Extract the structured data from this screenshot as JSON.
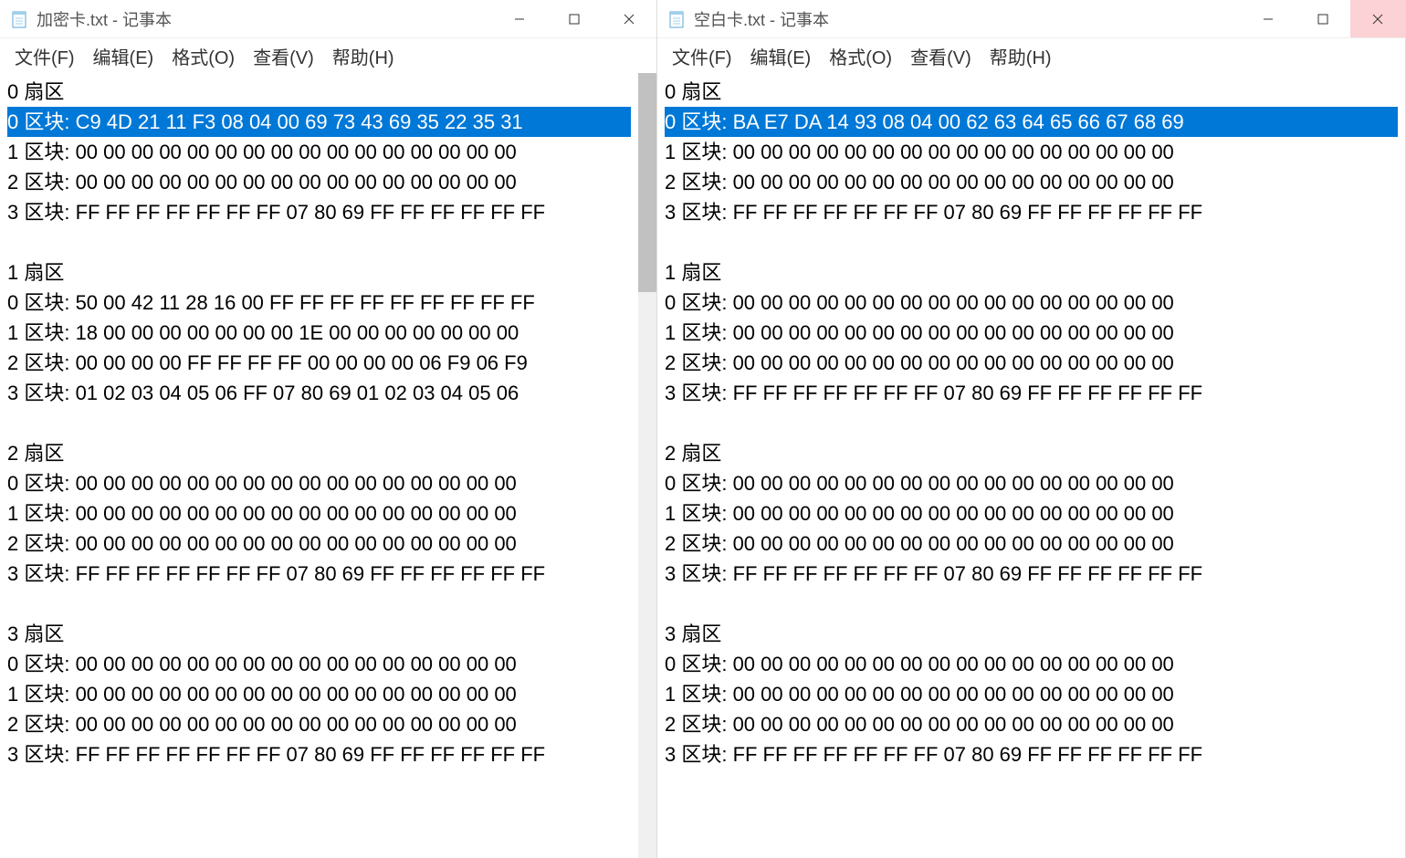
{
  "windows": [
    {
      "title": "加密卡.txt - 记事本",
      "close_style": "normal",
      "has_scrollbar": true,
      "menu": [
        "文件(F)",
        "编辑(E)",
        "格式(O)",
        "查看(V)",
        "帮助(H)"
      ],
      "sectors": [
        {
          "header": "0 扇区",
          "blocks": [
            {
              "text": "0 区块: C9 4D 21 11 F3 08 04 00 69 73 43 69 35 22 35 31",
              "selected": true
            },
            {
              "text": "1 区块: 00 00 00 00 00 00 00 00 00 00 00 00 00 00 00 00",
              "selected": false
            },
            {
              "text": "2 区块: 00 00 00 00 00 00 00 00 00 00 00 00 00 00 00 00",
              "selected": false
            },
            {
              "text": "3 区块: FF FF FF FF FF FF FF 07 80 69 FF FF FF FF FF FF",
              "selected": false
            }
          ]
        },
        {
          "header": "1 扇区",
          "blocks": [
            {
              "text": "0 区块: 50 00 42 11 28 16 00 FF FF FF FF FF FF FF FF FF",
              "selected": false
            },
            {
              "text": "1 区块: 18 00 00 00 00 00 00 00 1E 00 00 00 00 00 00 00",
              "selected": false
            },
            {
              "text": "2 区块: 00 00 00 00 FF FF FF FF 00 00 00 00 06 F9 06 F9",
              "selected": false
            },
            {
              "text": "3 区块: 01 02 03 04 05 06 FF 07 80 69 01 02 03 04 05 06",
              "selected": false
            }
          ]
        },
        {
          "header": "2 扇区",
          "blocks": [
            {
              "text": "0 区块: 00 00 00 00 00 00 00 00 00 00 00 00 00 00 00 00",
              "selected": false
            },
            {
              "text": "1 区块: 00 00 00 00 00 00 00 00 00 00 00 00 00 00 00 00",
              "selected": false
            },
            {
              "text": "2 区块: 00 00 00 00 00 00 00 00 00 00 00 00 00 00 00 00",
              "selected": false
            },
            {
              "text": "3 区块: FF FF FF FF FF FF FF 07 80 69 FF FF FF FF FF FF",
              "selected": false
            }
          ]
        },
        {
          "header": "3 扇区",
          "blocks": [
            {
              "text": "0 区块: 00 00 00 00 00 00 00 00 00 00 00 00 00 00 00 00",
              "selected": false
            },
            {
              "text": "1 区块: 00 00 00 00 00 00 00 00 00 00 00 00 00 00 00 00",
              "selected": false
            },
            {
              "text": "2 区块: 00 00 00 00 00 00 00 00 00 00 00 00 00 00 00 00",
              "selected": false
            },
            {
              "text": "3 区块: FF FF FF FF FF FF FF 07 80 69 FF FF FF FF FF FF",
              "selected": false
            }
          ]
        }
      ]
    },
    {
      "title": "空白卡.txt - 记事本",
      "close_style": "pink",
      "has_scrollbar": false,
      "menu": [
        "文件(F)",
        "编辑(E)",
        "格式(O)",
        "查看(V)",
        "帮助(H)"
      ],
      "sectors": [
        {
          "header": "0 扇区",
          "blocks": [
            {
              "text": "0 区块: BA E7 DA 14 93 08 04 00 62 63 64 65 66 67 68 69",
              "selected": true
            },
            {
              "text": "1 区块: 00 00 00 00 00 00 00 00 00 00 00 00 00 00 00 00",
              "selected": false
            },
            {
              "text": "2 区块: 00 00 00 00 00 00 00 00 00 00 00 00 00 00 00 00",
              "selected": false
            },
            {
              "text": "3 区块: FF FF FF FF FF FF FF 07 80 69 FF FF FF FF FF FF",
              "selected": false
            }
          ]
        },
        {
          "header": "1 扇区",
          "blocks": [
            {
              "text": "0 区块: 00 00 00 00 00 00 00 00 00 00 00 00 00 00 00 00",
              "selected": false
            },
            {
              "text": "1 区块: 00 00 00 00 00 00 00 00 00 00 00 00 00 00 00 00",
              "selected": false
            },
            {
              "text": "2 区块: 00 00 00 00 00 00 00 00 00 00 00 00 00 00 00 00",
              "selected": false
            },
            {
              "text": "3 区块: FF FF FF FF FF FF FF 07 80 69 FF FF FF FF FF FF",
              "selected": false
            }
          ]
        },
        {
          "header": "2 扇区",
          "blocks": [
            {
              "text": "0 区块: 00 00 00 00 00 00 00 00 00 00 00 00 00 00 00 00",
              "selected": false
            },
            {
              "text": "1 区块: 00 00 00 00 00 00 00 00 00 00 00 00 00 00 00 00",
              "selected": false
            },
            {
              "text": "2 区块: 00 00 00 00 00 00 00 00 00 00 00 00 00 00 00 00",
              "selected": false
            },
            {
              "text": "3 区块: FF FF FF FF FF FF FF 07 80 69 FF FF FF FF FF FF",
              "selected": false
            }
          ]
        },
        {
          "header": "3 扇区",
          "blocks": [
            {
              "text": "0 区块: 00 00 00 00 00 00 00 00 00 00 00 00 00 00 00 00",
              "selected": false
            },
            {
              "text": "1 区块: 00 00 00 00 00 00 00 00 00 00 00 00 00 00 00 00",
              "selected": false
            },
            {
              "text": "2 区块: 00 00 00 00 00 00 00 00 00 00 00 00 00 00 00 00",
              "selected": false
            },
            {
              "text": "3 区块: FF FF FF FF FF FF FF 07 80 69 FF FF FF FF FF FF",
              "selected": false
            }
          ]
        }
      ]
    }
  ]
}
